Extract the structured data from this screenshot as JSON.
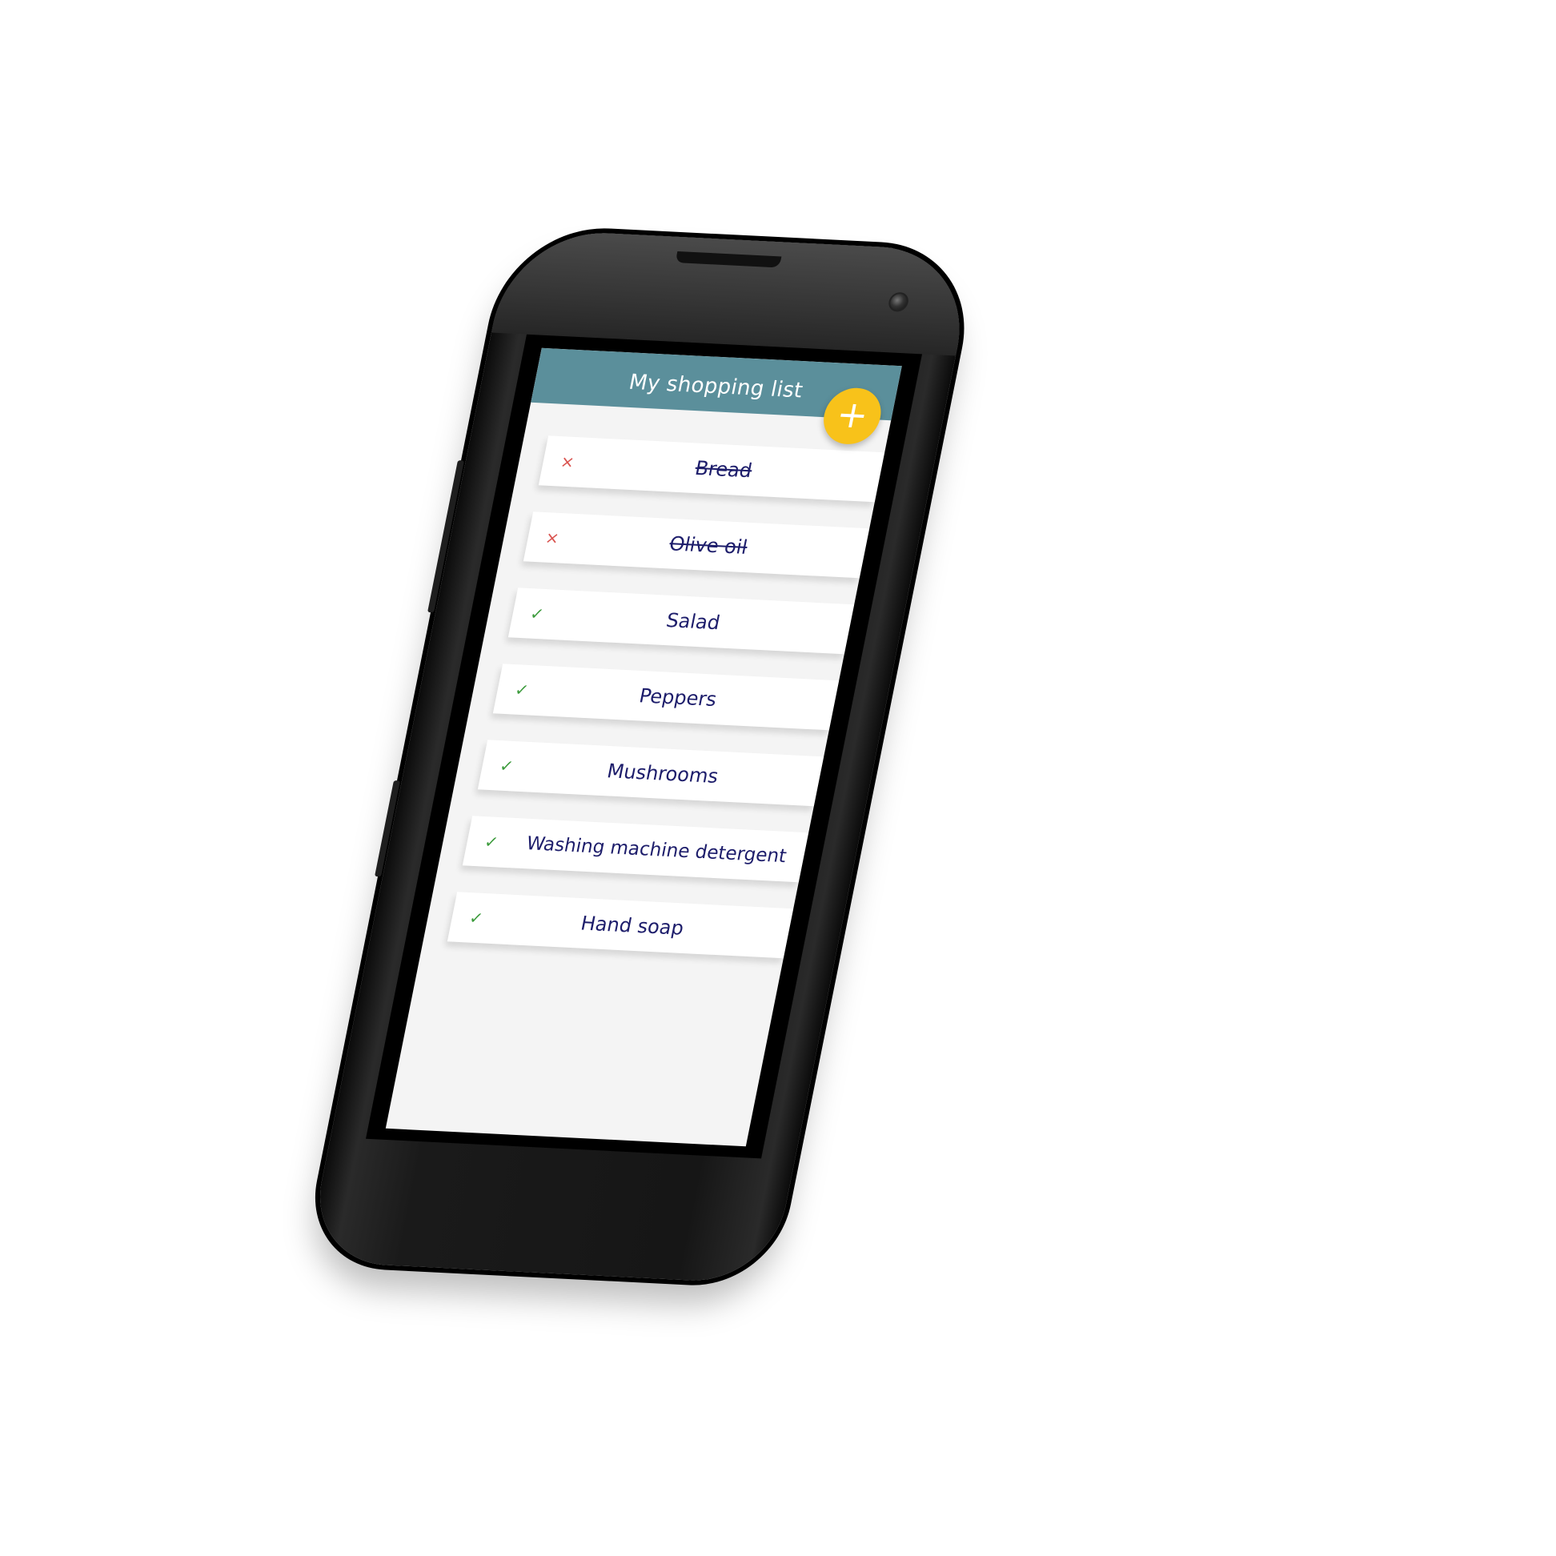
{
  "app": {
    "title": "My shopping list",
    "add_button_glyph": "+"
  },
  "colors": {
    "header": "#5b8f9b",
    "fab": "#f8c21a",
    "item_text": "#1d1d6b",
    "remove_icon": "#d9534f",
    "check_icon": "#3a9a3a"
  },
  "items": [
    {
      "label": "Bread",
      "status": "removed",
      "icon": "×",
      "icon_name": "cross-icon"
    },
    {
      "label": "Olive oil",
      "status": "removed",
      "icon": "×",
      "icon_name": "cross-icon"
    },
    {
      "label": "Salad",
      "status": "active",
      "icon": "✓",
      "icon_name": "check-icon"
    },
    {
      "label": "Peppers",
      "status": "active",
      "icon": "✓",
      "icon_name": "check-icon"
    },
    {
      "label": "Mushrooms",
      "status": "active",
      "icon": "✓",
      "icon_name": "check-icon"
    },
    {
      "label": "Washing machine detergent",
      "status": "active",
      "icon": "✓",
      "icon_name": "check-icon"
    },
    {
      "label": "Hand soap",
      "status": "active",
      "icon": "✓",
      "icon_name": "check-icon"
    }
  ]
}
